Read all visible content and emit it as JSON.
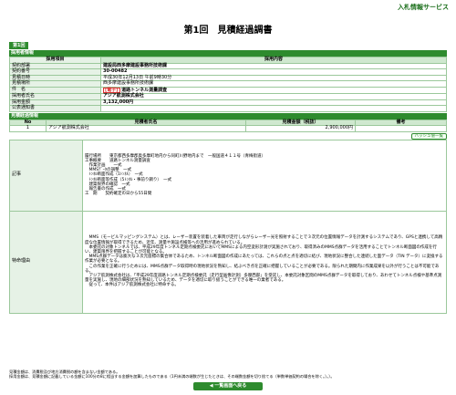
{
  "header": {
    "service": "入札情報サービス",
    "title": "第1回　見積経過調書"
  },
  "badge": "第1回",
  "section_award": {
    "heading": "採用者情報",
    "col_item": "採用項目",
    "col_content": "採用内容",
    "rows": [
      {
        "label": "契約部署",
        "value": "建設局西多摩建設事務所技術課",
        "bold": true
      },
      {
        "label": "契約番号",
        "value": "30-00482",
        "bold": true
      },
      {
        "label": "見積日時",
        "value": "平成30年12月13日 午前9時30分",
        "bold": false
      },
      {
        "label": "見積場所",
        "value": "西多摩建設事務所技術課",
        "bold": false
      },
      {
        "label": "件　名",
        "tag": "[電子]",
        "value": "道路トンネル測量調査",
        "bold": true
      },
      {
        "label": "採用者氏名",
        "value": "アジア航測株式会社",
        "bold": true
      },
      {
        "label": "採用金額",
        "value": "3,132,000円",
        "bold": true
      },
      {
        "label": "公表通知書",
        "value": "",
        "bold": false
      }
    ]
  },
  "section_estimate": {
    "heading": "見積経過情報",
    "col_no": "No",
    "col_name": "見積者氏名",
    "col_amount": "見積金額（税抜）",
    "col_memo": "備考",
    "rows": [
      {
        "no": "1",
        "name": "アジア航測株式会社",
        "amount": "2,900,000円",
        "memo": ""
      }
    ],
    "hash_button": "ハッシュ値一覧"
  },
  "remarks": {
    "label": "記事",
    "text": "履行場所　　東京都西多摩郡奥多摩町地内から同町川野地内まで　一般国道４１１号（青梅街道）\n工事概要　　道路トンネル測量調査\n　作業計画　　一式\n　MMSﾃﾞｰﾀの調整　一式\n　ﾄﾝﾈﾙ断面作成（1ﾄﾝﾈﾙ）　一式\n　ﾄﾝﾈﾙ断面等作成（5ﾄﾝﾈﾙ・事前り鋼り）　一式\n　建築限界の確認　一式\n　報告書の作成　一式\n工　期　　契約確定の日から55日間"
  },
  "reason": {
    "label": "特命理由",
    "text": "　MMS（モービルマッピングシステム）とは、レーザー装置を装着した車両が走行しながらレーザー光を照射することで３次元の位置情報データを計測するシステムであり、GPSと連携して高精度な位置情報が取得できるため、近年、測量や施設点検等への活用が進められている。\n　本委託の対象トンネルでは、平成29年度トンネル定期点検委託においてMMSによる内空変形計測が実施されており、取得済みのMMS点群データを活用することでトンネル断面図の作成を行い、建築限界を把握することが可能となる。\n　MMS点群データは膨大な３次元座標の集合体であるため、トンネル断面図の作成にあたっては、これらの点と点を適切に結び、現地状況に整合した連続した面データ（TIN データ）に変換する作業が必要となる。\n　この作業を正確に行うためには、MMS点群データ取得時の現地状況を熟知し、結ぶべき点を正確に把握していることが必要である。限られた期間内に作業成果を以外が行うことは不可能である。\n　アジア航測株式会社は、「平成29年度道路トンネル定期点検委託（走行型画像計測）多摩西部」を受託し、本委託対象区間のMMS点群データを取得しており、あわせてトンネル点検や基準点測量を実施し、現地の細部状況を熟知しているため、データを適切に取り扱うことができる唯一の業者である。\n　従って、本件はアジア航測株式会社に特命する。"
  },
  "footer": {
    "line1": "見積金額は、消費税及び地方消費税の額を含まない金額である。",
    "line2": "採用金額は、見積金額に記載している金額に100分の8に相当する金額を加算したものである（1円未満の端数が生じたときは、その端数金額を切り捨てる（単数単価契約の場合を除く。）。）。"
  },
  "back_button": "◀ 一覧画面へ戻る"
}
